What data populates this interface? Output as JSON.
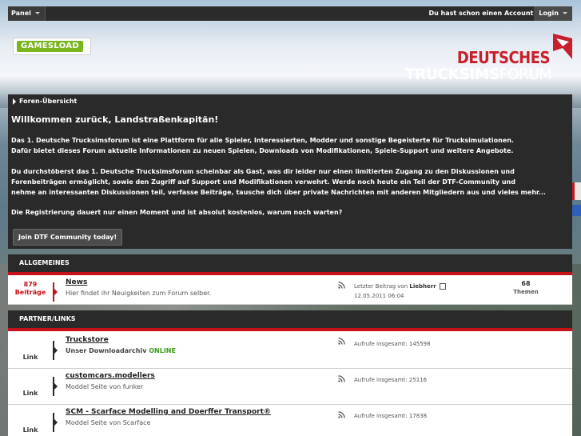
{
  "topbar": {
    "panel_label": "Panel",
    "login_question": "Du hast schon einen Account?",
    "login_label": "Login"
  },
  "header": {
    "gamesload_logo": "GAMESLOAD",
    "logo_line1": "DEUTSCHES",
    "logo_line2_bold": "TRUCKSIMS",
    "logo_line2_light": "FORUM"
  },
  "breadcrumb": {
    "label": "Foren-Übersicht"
  },
  "welcome": {
    "title": "Willkommen zurück, Landstraßenkapitän!",
    "p1_line1": "Das 1. Deutsche Trucksimsforum ist eine Plattform für alle Spieler, Interessierten, Modder und sonstige Begeisterte für Trucksimulationen.",
    "p1_line2": "Dafür bietet dieses Forum aktuelle Informationen zu neuen Spielen, Downloads von Modifikationen, Spiele-Support und weitere Angebote.",
    "p2_line1": "Du durchstöberst das 1. Deutsche Trucksimsforum scheinbar als Gast, was dir leider nur einen limitierten Zugang zu den Diskussionen und",
    "p2_line2": "Forenbeiträgen ermöglicht, sowie den Zugriff auf Support und Modifikationen verwehrt. Werde noch heute ein Teil der DTF-Community und",
    "p2_line3": "nehme an interessanten Diskussionen teil, verfasse Beiträge, tausche dich über private Nachrichten mit anderen Mitgliedern aus und vieles mehr...",
    "p3": "Die Registrierung dauert nur einen Moment und ist absolut kostenlos, warum noch warten?",
    "join_button": "Join DTF Community today!"
  },
  "categories": [
    {
      "title": "ALLGEMEINES",
      "forums": [
        {
          "count": "879",
          "count_label": "Beiträge",
          "title": "News",
          "desc": "Hier findet ihr Neuigkeiten zum Forum selber.",
          "last_label": "Letzter Beitrag von",
          "last_user": "Liebherr",
          "last_date": "12.05.2011 06:04",
          "topics": "68",
          "topics_label": "Themen"
        }
      ]
    },
    {
      "title": "PARTNER/LINKS",
      "links": [
        {
          "label": "Link",
          "title": "Truckstore",
          "desc": "Unser Downloadarchiv",
          "desc_extra": "ONLINE",
          "meta": "Aufrufe insgesamt: 145598"
        },
        {
          "label": "Link",
          "title": "customcars.modellers",
          "desc": "Moddel Seite von funker",
          "desc_extra": "",
          "meta": "Aufrufe insgesamt: 25116"
        },
        {
          "label": "Link",
          "title": "SCM - Scarface Modelling and Doerffer Transport®",
          "desc": "Moddel Seite von Scarface",
          "desc_extra": "",
          "meta": "Aufrufe insgesamt: 17838"
        }
      ]
    }
  ],
  "colors": {
    "accent": "#c4121b",
    "dark": "#2a2a2a",
    "online": "#3a9b1a",
    "gamesload": "#7ab51d"
  },
  "icons": {
    "rss": "rss-feed-icon",
    "breadcrumb": "arrow-right-icon",
    "last_post": "last-post-icon"
  }
}
